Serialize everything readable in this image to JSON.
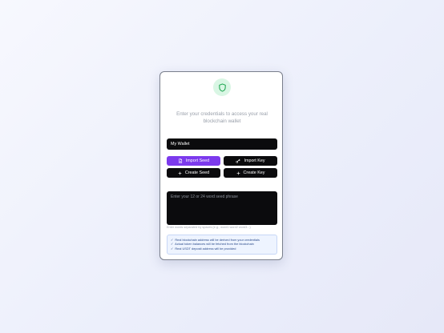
{
  "card": {
    "icon": "shield-icon",
    "subtitle": "Enter your credentials to access your real blockchain wallet"
  },
  "wallet_name": {
    "value": "My Wallet"
  },
  "buttons": {
    "import_seed": {
      "label": "Import Seed",
      "icon": "file-icon"
    },
    "import_key": {
      "label": "Import Key",
      "icon": "key-icon"
    },
    "create_seed": {
      "label": "Create Seed",
      "icon": "plus-icon"
    },
    "create_key": {
      "label": "Create Key",
      "icon": "plus-icon"
    }
  },
  "seed_phrase": {
    "placeholder": "Enter your 12 or 24 word seed phrase",
    "hint": "Enter words separated by spaces (e.g., word1 word2 word3...)"
  },
  "info": {
    "check_icon": "check-icon",
    "lines": [
      "Real blockchain address will be derived from your credentials",
      "Actual token balances will be fetched from the blockchain",
      "Real USDT deposit address will be provided"
    ]
  },
  "colors": {
    "accent": "#7c3aed",
    "dark_field": "#0b0b0d",
    "shield": "#16a34a",
    "info_bg": "#eef4ff"
  }
}
